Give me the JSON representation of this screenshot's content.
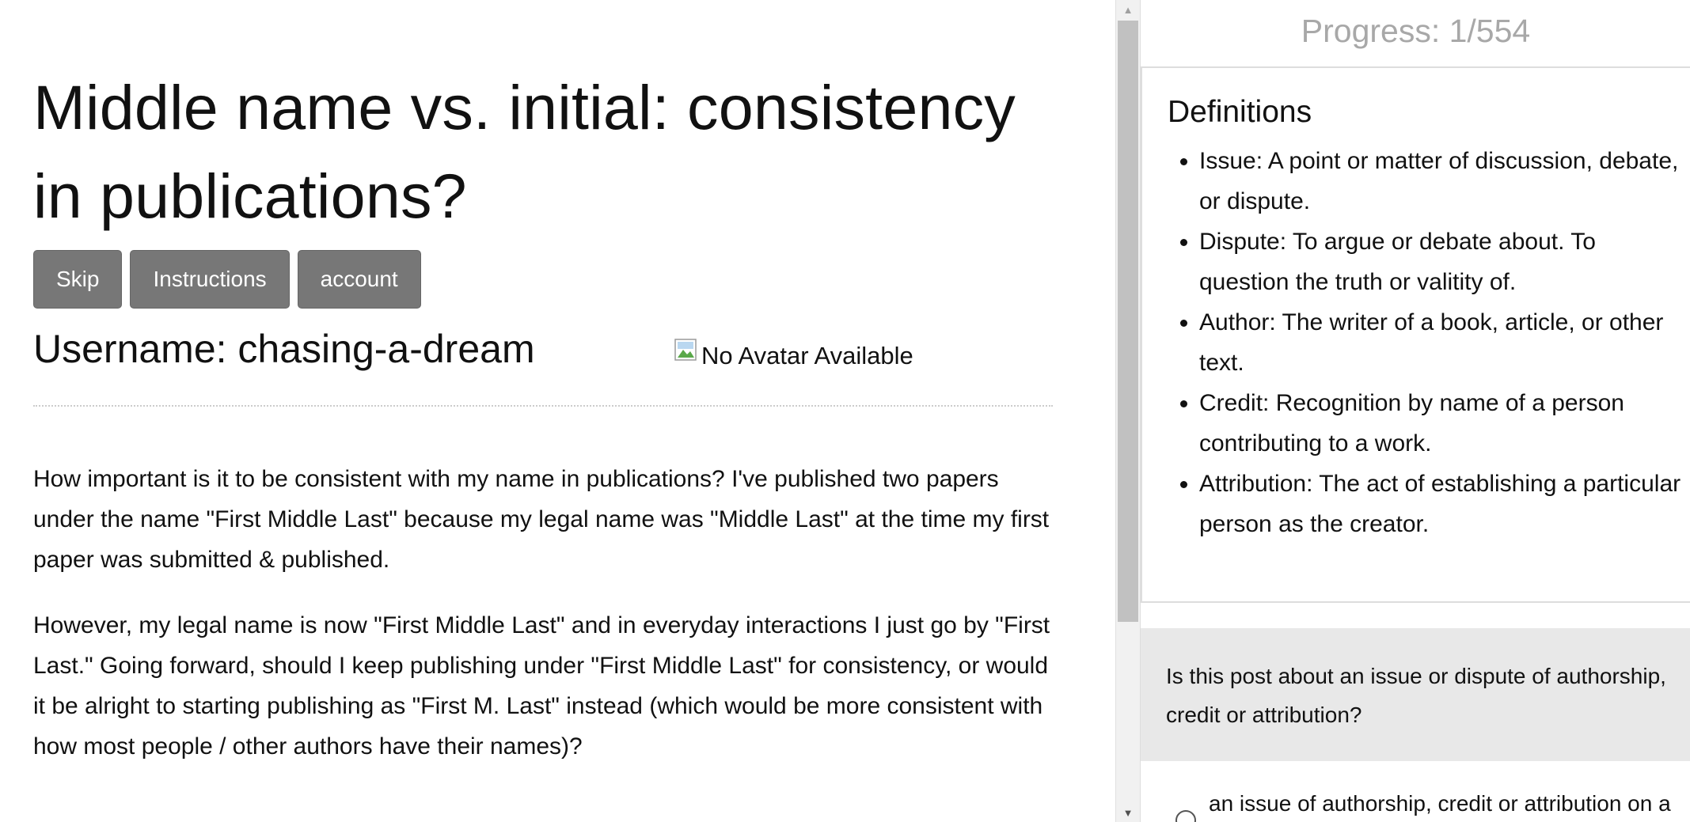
{
  "post": {
    "title": "Middle name vs. initial: consistency in publications?",
    "username": "Username: chasing-a-dream",
    "avatar_alt": "No Avatar Available",
    "paragraphs": [
      "How important is it to be consistent with my name in publications? I've published two papers under the name \"First Middle Last\" because my legal name was \"Middle Last\" at the time my first paper was submitted & published.",
      "However, my legal name is now \"First Middle Last\" and in everyday interactions I just go by \"First Last.\" Going forward, should I keep publishing under \"First Middle Last\" for consistency, or would it be alright to starting publishing as \"First M. Last\" instead (which would be more consistent with how most people / other authors have their names)?"
    ]
  },
  "buttons": {
    "skip": "Skip",
    "instructions": "Instructions",
    "account": "account"
  },
  "sidebar": {
    "progress": "Progress: 1/554",
    "definitions_title": "Definitions",
    "definitions": [
      "Issue: A point or matter of discussion, debate, or dispute.",
      "Dispute: To argue or debate about. To question the truth or valitity of.",
      "Author: The writer of a book, article, or other text.",
      "Credit: Recognition by name of a person contributing to a work.",
      "Attribution: The act of establishing a particular person as the creator."
    ],
    "question": "Is this post about an issue or dispute of authorship, credit or attribution?",
    "options": [
      "an issue of authorship, credit or attribution on a scientific publication"
    ]
  },
  "scrollbar": {
    "up_icon": "triangle-up-icon",
    "down_icon": "triangle-down-icon"
  }
}
